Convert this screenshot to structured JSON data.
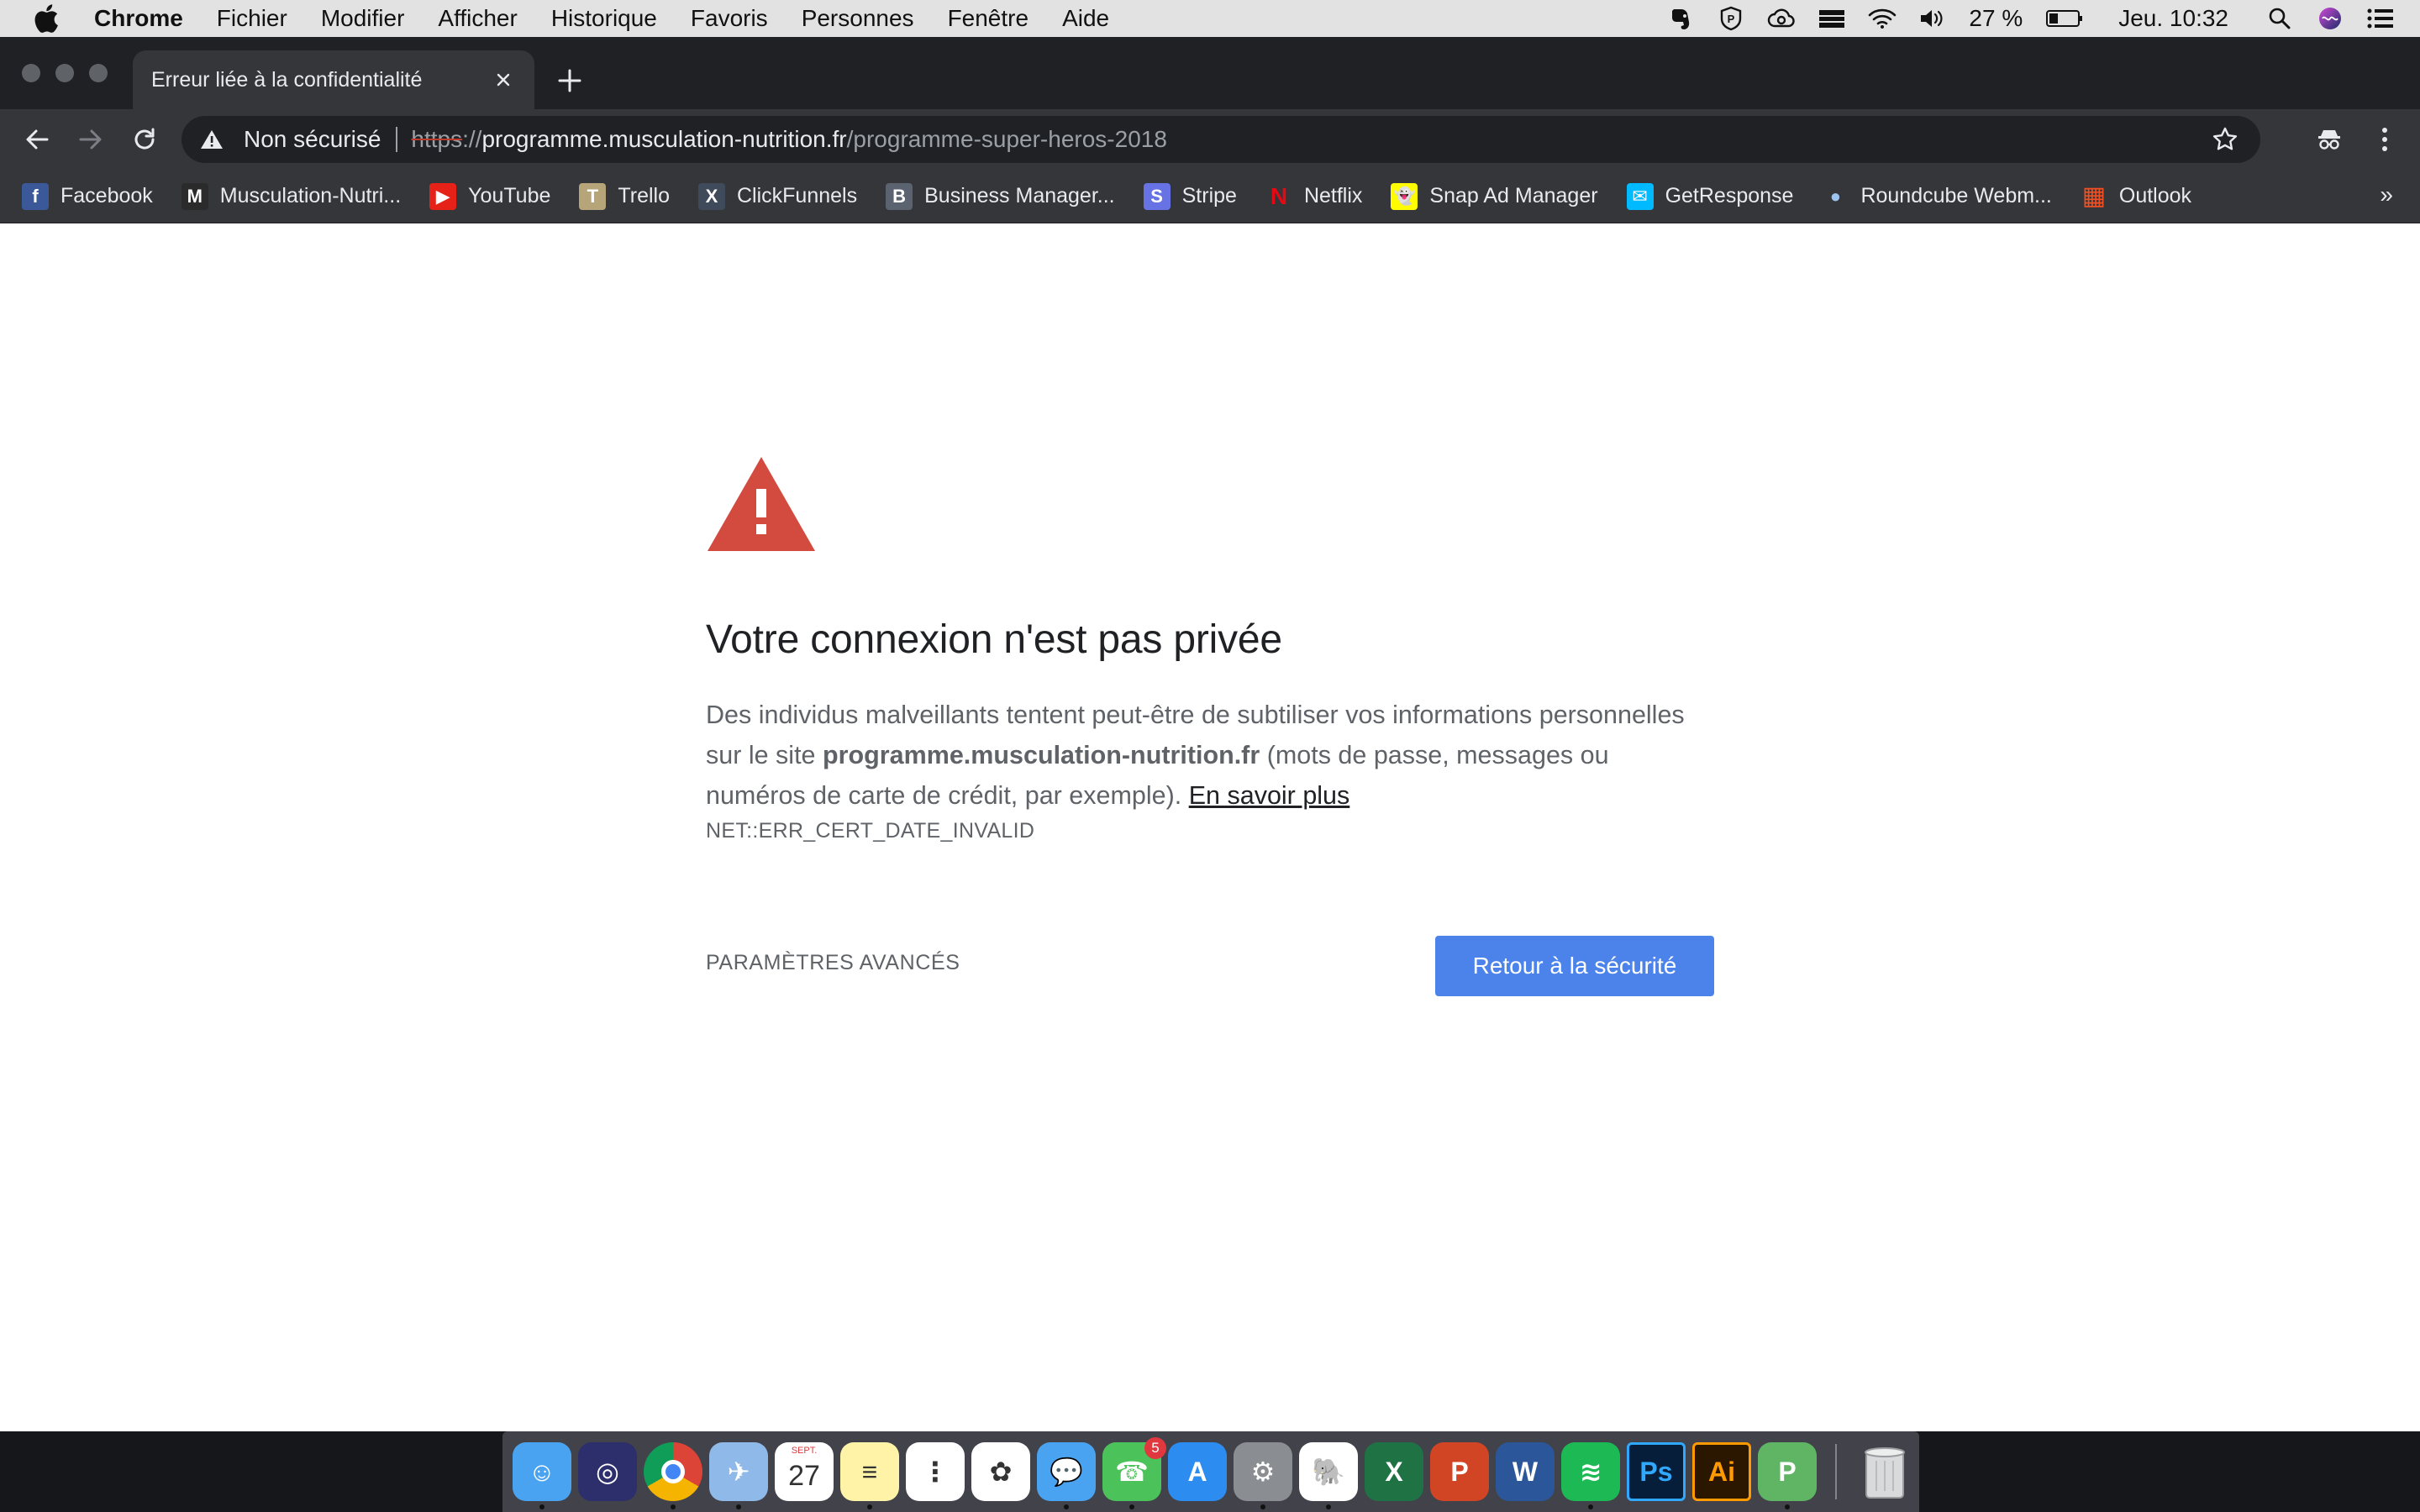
{
  "menubar": {
    "app": "Chrome",
    "items": [
      "Fichier",
      "Modifier",
      "Afficher",
      "Historique",
      "Favoris",
      "Personnes",
      "Fenêtre",
      "Aide"
    ],
    "battery": "27 %",
    "clock": "Jeu. 10:32"
  },
  "tab": {
    "title": "Erreur liée à la confidentialité"
  },
  "omnibox": {
    "security_label": "Non sécurisé",
    "scheme": "https",
    "separator": "://",
    "host": "programme.musculation-nutrition.fr",
    "path": "/programme-super-heros-2018"
  },
  "bookmarks": [
    {
      "label": "Facebook",
      "icon": "facebook-icon",
      "color": "#3b5998",
      "glyph": "f"
    },
    {
      "label": "Musculation-Nutri...",
      "icon": "musculation-icon",
      "color": "#2b2b2b",
      "glyph": "M"
    },
    {
      "label": "YouTube",
      "icon": "youtube-icon",
      "color": "#e62117",
      "glyph": "▶"
    },
    {
      "label": "Trello",
      "icon": "trello-icon",
      "color": "#b7a57a",
      "glyph": "T"
    },
    {
      "label": "ClickFunnels",
      "icon": "clickfunnels-icon",
      "color": "#3f4a5a",
      "glyph": "X"
    },
    {
      "label": "Business Manager...",
      "icon": "business-manager-icon",
      "color": "#5b6270",
      "glyph": "B"
    },
    {
      "label": "Stripe",
      "icon": "stripe-icon",
      "color": "#6772e5",
      "glyph": "S"
    },
    {
      "label": "Netflix",
      "icon": "netflix-icon",
      "color": "#35363a",
      "glyph": "N"
    },
    {
      "label": "Snap Ad Manager",
      "icon": "snapchat-icon",
      "color": "#fffc00",
      "glyph": "👻"
    },
    {
      "label": "GetResponse",
      "icon": "getresponse-icon",
      "color": "#00baff",
      "glyph": "✉"
    },
    {
      "label": "Roundcube Webm...",
      "icon": "roundcube-icon",
      "color": "#35363a",
      "glyph": "●"
    },
    {
      "label": "Outlook",
      "icon": "outlook-icon",
      "color": "#35363a",
      "glyph": "▦"
    }
  ],
  "bookmarks_more": "»",
  "page": {
    "heading": "Votre connexion n'est pas privée",
    "body_1": "Des individus malveillants tentent peut-être de subtiliser vos informations personnelles sur le site ",
    "body_host": "programme.musculation-nutrition.fr",
    "body_2": " (mots de passe, messages ou numéros de carte de crédit, par exemple). ",
    "learn_more": "En savoir plus",
    "error_code": "NET::ERR_CERT_DATE_INVALID",
    "advanced_label": "PARAMÈTRES AVANCÉS",
    "back_label": "Retour à la sécurité"
  },
  "colors": {
    "primary_button": "#4b83ea",
    "warning_red": "#d34b3f",
    "chrome_dark": "#35363a"
  },
  "dock": [
    {
      "name": "finder-icon",
      "color": "#4aa3f0",
      "glyph": "☺",
      "running": true
    },
    {
      "name": "siri-icon",
      "color": "#2c2f6b",
      "glyph": "◎",
      "running": false
    },
    {
      "name": "chrome-icon",
      "color": "#ffffff",
      "glyph": "",
      "running": true
    },
    {
      "name": "mail-icon",
      "color": "#8fb9e8",
      "glyph": "✈",
      "running": true
    },
    {
      "name": "calendar-icon",
      "color": "#ffffff",
      "glyph": "27",
      "label_top": "SEPT.",
      "running": false
    },
    {
      "name": "notes-icon",
      "color": "#fff3a8",
      "glyph": "≡",
      "running": true
    },
    {
      "name": "reminders-icon",
      "color": "#ffffff",
      "glyph": "⋮",
      "running": false
    },
    {
      "name": "photos-icon",
      "color": "#ffffff",
      "glyph": "✿",
      "running": false
    },
    {
      "name": "messages-icon",
      "color": "#4aa3f0",
      "glyph": "💬",
      "running": true
    },
    {
      "name": "facetime-icon",
      "color": "#4cc25a",
      "glyph": "☎",
      "badge": "5",
      "running": true
    },
    {
      "name": "app-store-icon",
      "color": "#2d8cf0",
      "glyph": "A",
      "running": false
    },
    {
      "name": "system-preferences-icon",
      "color": "#8a8d92",
      "glyph": "⚙",
      "running": true
    },
    {
      "name": "evernote-icon",
      "color": "#ffffff",
      "glyph": "🐘",
      "running": true
    },
    {
      "name": "excel-icon",
      "color": "#1f7244",
      "glyph": "X",
      "running": false
    },
    {
      "name": "powerpoint-icon",
      "color": "#d14524",
      "glyph": "P",
      "running": false
    },
    {
      "name": "word-icon",
      "color": "#2b579a",
      "glyph": "W",
      "running": false
    },
    {
      "name": "spotify-icon",
      "color": "#1db954",
      "glyph": "≋",
      "running": true
    },
    {
      "name": "photoshop-icon",
      "color": "#061e3a",
      "glyph": "Ps",
      "running": false
    },
    {
      "name": "illustrator-icon",
      "color": "#2b1600",
      "glyph": "Ai",
      "running": false
    },
    {
      "name": "vpn-shield-icon",
      "color": "#5fb563",
      "glyph": "P",
      "running": true
    }
  ],
  "trash": {
    "name": "trash-icon"
  }
}
